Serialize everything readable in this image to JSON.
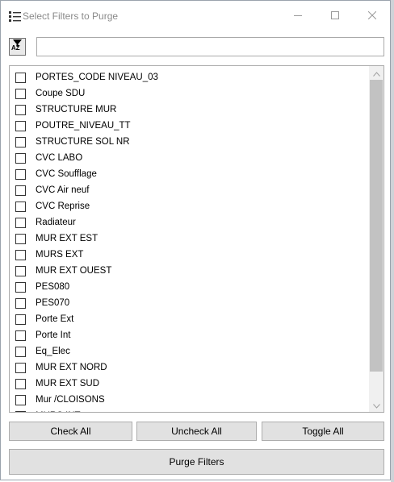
{
  "window": {
    "title": "Select Filters to Purge"
  },
  "icons": {
    "app": "list-icon",
    "sort": "sort-az-icon",
    "minimize": "minimize-icon",
    "maximize": "maximize-icon",
    "close": "close-icon",
    "scroll_up": "chevron-up-icon",
    "scroll_down": "chevron-down-icon"
  },
  "sort_button": {
    "label": "AZ"
  },
  "search": {
    "value": ""
  },
  "filters": [
    {
      "label": "PORTES_CODE NIVEAU_03",
      "checked": false
    },
    {
      "label": "Coupe SDU",
      "checked": false
    },
    {
      "label": "STRUCTURE MUR",
      "checked": false
    },
    {
      "label": "POUTRE_NIVEAU_TT",
      "checked": false
    },
    {
      "label": "STRUCTURE SOL NR",
      "checked": false
    },
    {
      "label": "CVC LABO",
      "checked": false
    },
    {
      "label": "CVC Soufflage",
      "checked": false
    },
    {
      "label": "CVC Air neuf",
      "checked": false
    },
    {
      "label": "CVC Reprise",
      "checked": false
    },
    {
      "label": "Radiateur",
      "checked": false
    },
    {
      "label": "MUR EXT EST",
      "checked": false
    },
    {
      "label": "MURS EXT",
      "checked": false
    },
    {
      "label": "MUR EXT OUEST",
      "checked": false
    },
    {
      "label": "PES080",
      "checked": false
    },
    {
      "label": "PES070",
      "checked": false
    },
    {
      "label": "Porte Ext",
      "checked": false
    },
    {
      "label": "Porte Int",
      "checked": false
    },
    {
      "label": "Eq_Elec",
      "checked": false
    },
    {
      "label": "MUR EXT NORD",
      "checked": false
    },
    {
      "label": "MUR EXT SUD",
      "checked": false
    },
    {
      "label": "Mur /CLOISONS",
      "checked": false
    },
    {
      "label": "MURS INT",
      "checked": false
    }
  ],
  "buttons": {
    "check_all": "Check All",
    "uncheck_all": "Uncheck All",
    "toggle_all": "Toggle All",
    "purge": "Purge Filters"
  },
  "colors": {
    "scroll_thumb": "#c2c2c2",
    "button_face": "#e1e1e1",
    "title_text": "#8a8a8a"
  }
}
